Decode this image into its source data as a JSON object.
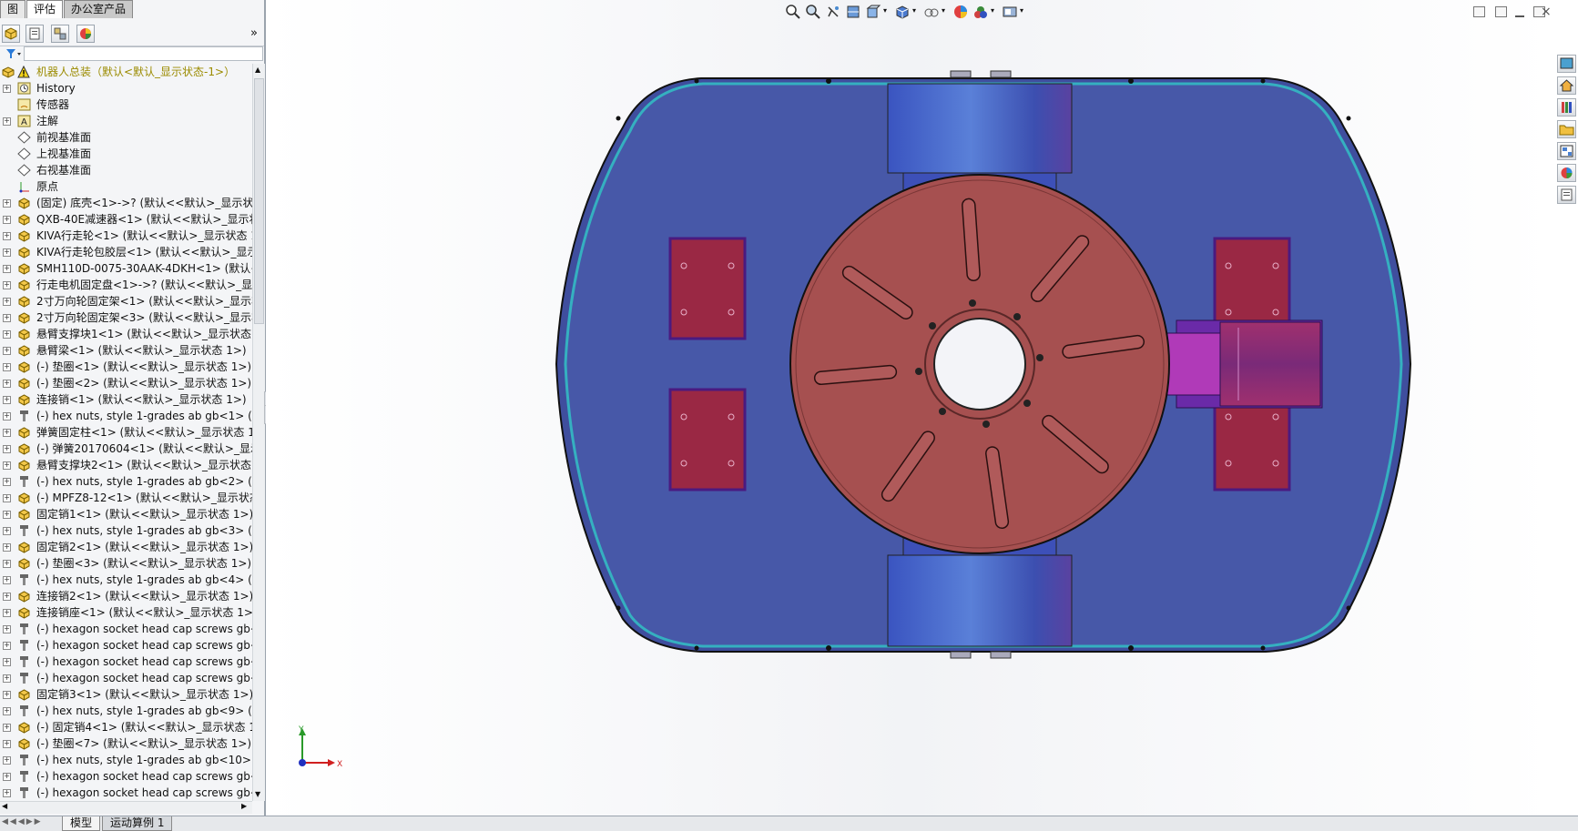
{
  "top_tabs": [
    "图",
    "评估",
    "办公室产品"
  ],
  "tree": {
    "root": "机器人总装（默认<默认_显示状态-1>）",
    "items": [
      {
        "label": "History",
        "icon": "history-icon",
        "exp": true
      },
      {
        "label": "传感器",
        "icon": "sensor-icon",
        "exp": false
      },
      {
        "label": "注解",
        "icon": "annotation-icon",
        "exp": true
      },
      {
        "label": "前视基准面",
        "icon": "plane-icon",
        "exp": false
      },
      {
        "label": "上视基准面",
        "icon": "plane-icon",
        "exp": false
      },
      {
        "label": "右视基准面",
        "icon": "plane-icon",
        "exp": false
      },
      {
        "label": "原点",
        "icon": "origin-icon",
        "exp": false
      },
      {
        "label": "(固定) 底壳<1>->? (默认<<默认>_显示状态",
        "icon": "part-icon",
        "exp": true
      },
      {
        "label": "QXB-40E减速器<1> (默认<<默认>_显示状",
        "icon": "part-icon",
        "exp": true
      },
      {
        "label": "KIVA行走轮<1> (默认<<默认>_显示状态 1",
        "icon": "part-icon",
        "exp": true
      },
      {
        "label": "KIVA行走轮包胶层<1> (默认<<默认>_显示",
        "icon": "part-icon",
        "exp": true
      },
      {
        "label": "SMH110D-0075-30AAK-4DKH<1> (默认<",
        "icon": "part-icon",
        "exp": true
      },
      {
        "label": "行走电机固定盘<1>->? (默认<<默认>_显示",
        "icon": "part-icon",
        "exp": true
      },
      {
        "label": "2寸万向轮固定架<1> (默认<<默认>_显示状",
        "icon": "part-icon",
        "exp": true
      },
      {
        "label": "2寸万向轮固定架<3> (默认<<默认>_显示状",
        "icon": "part-icon",
        "exp": true
      },
      {
        "label": "悬臂支撑块1<1> (默认<<默认>_显示状态 1",
        "icon": "part-icon",
        "exp": true
      },
      {
        "label": "悬臂梁<1> (默认<<默认>_显示状态 1>)",
        "icon": "part-icon",
        "exp": true
      },
      {
        "label": "(-) 垫圈<1> (默认<<默认>_显示状态 1>)",
        "icon": "part-icon",
        "exp": true
      },
      {
        "label": "(-) 垫圈<2> (默认<<默认>_显示状态 1>)",
        "icon": "part-icon",
        "exp": true
      },
      {
        "label": "连接销<1> (默认<<默认>_显示状态 1>)",
        "icon": "part-icon",
        "exp": true
      },
      {
        "label": "(-) hex nuts, style 1-grades ab gb<1> (G",
        "icon": "toolbox-part-icon",
        "exp": true
      },
      {
        "label": "弹簧固定柱<1> (默认<<默认>_显示状态 1>",
        "icon": "part-icon",
        "exp": true
      },
      {
        "label": "(-) 弹簧20170604<1> (默认<<默认>_显示",
        "icon": "part-icon",
        "exp": true
      },
      {
        "label": "悬臂支撑块2<1> (默认<<默认>_显示状态 1",
        "icon": "part-icon",
        "exp": true
      },
      {
        "label": "(-) hex nuts, style 1-grades ab gb<2> (G",
        "icon": "toolbox-part-icon",
        "exp": true
      },
      {
        "label": "(-) MPFZ8-12<1> (默认<<默认>_显示状态",
        "icon": "part-icon",
        "exp": true
      },
      {
        "label": "固定销1<1> (默认<<默认>_显示状态 1>)",
        "icon": "part-icon",
        "exp": true
      },
      {
        "label": "(-) hex nuts, style 1-grades ab gb<3> (G",
        "icon": "toolbox-part-icon",
        "exp": true
      },
      {
        "label": "固定销2<1> (默认<<默认>_显示状态 1>)",
        "icon": "part-icon",
        "exp": true
      },
      {
        "label": "(-) 垫圈<3> (默认<<默认>_显示状态 1>)",
        "icon": "part-icon",
        "exp": true
      },
      {
        "label": "(-) hex nuts, style 1-grades ab gb<4> (G",
        "icon": "toolbox-part-icon",
        "exp": true
      },
      {
        "label": "连接销2<1> (默认<<默认>_显示状态 1>)",
        "icon": "part-icon",
        "exp": true
      },
      {
        "label": "连接销座<1> (默认<<默认>_显示状态 1>)",
        "icon": "part-icon",
        "exp": true
      },
      {
        "label": "(-) hexagon socket head cap screws gb<",
        "icon": "toolbox-part-icon",
        "exp": true
      },
      {
        "label": "(-) hexagon socket head cap screws gb<",
        "icon": "toolbox-part-icon",
        "exp": true
      },
      {
        "label": "(-) hexagon socket head cap screws gb<",
        "icon": "toolbox-part-icon",
        "exp": true
      },
      {
        "label": "(-) hexagon socket head cap screws gb<",
        "icon": "toolbox-part-icon",
        "exp": true
      },
      {
        "label": "固定销3<1> (默认<<默认>_显示状态 1>)",
        "icon": "part-icon",
        "exp": true
      },
      {
        "label": "(-) hex nuts, style 1-grades ab gb<9> (G",
        "icon": "toolbox-part-icon",
        "exp": true
      },
      {
        "label": "(-) 固定销4<1> (默认<<默认>_显示状态 1>",
        "icon": "part-icon",
        "exp": true
      },
      {
        "label": "(-) 垫圈<7> (默认<<默认>_显示状态 1>)",
        "icon": "part-icon",
        "exp": true
      },
      {
        "label": "(-) hex nuts, style 1-grades ab gb<10> (",
        "icon": "toolbox-part-icon",
        "exp": true
      },
      {
        "label": "(-) hexagon socket head cap screws gb<",
        "icon": "toolbox-part-icon",
        "exp": true
      },
      {
        "label": "(-) hexagon socket head cap screws gb<",
        "icon": "toolbox-part-icon",
        "exp": true
      }
    ]
  },
  "bottom_tabs": [
    "模型",
    "运动算例 1"
  ],
  "triad": {
    "x_label": "X",
    "y_label": "Y"
  },
  "colors": {
    "chassis_blue": "#4a5aa8",
    "outline_teal": "#3aa0b0",
    "disk_red": "#a65050",
    "pad_red": "#9a2844",
    "pad_border": "#4a1a80",
    "arm_magenta": "#b03ab8",
    "tree_root": "#9b8b00"
  }
}
